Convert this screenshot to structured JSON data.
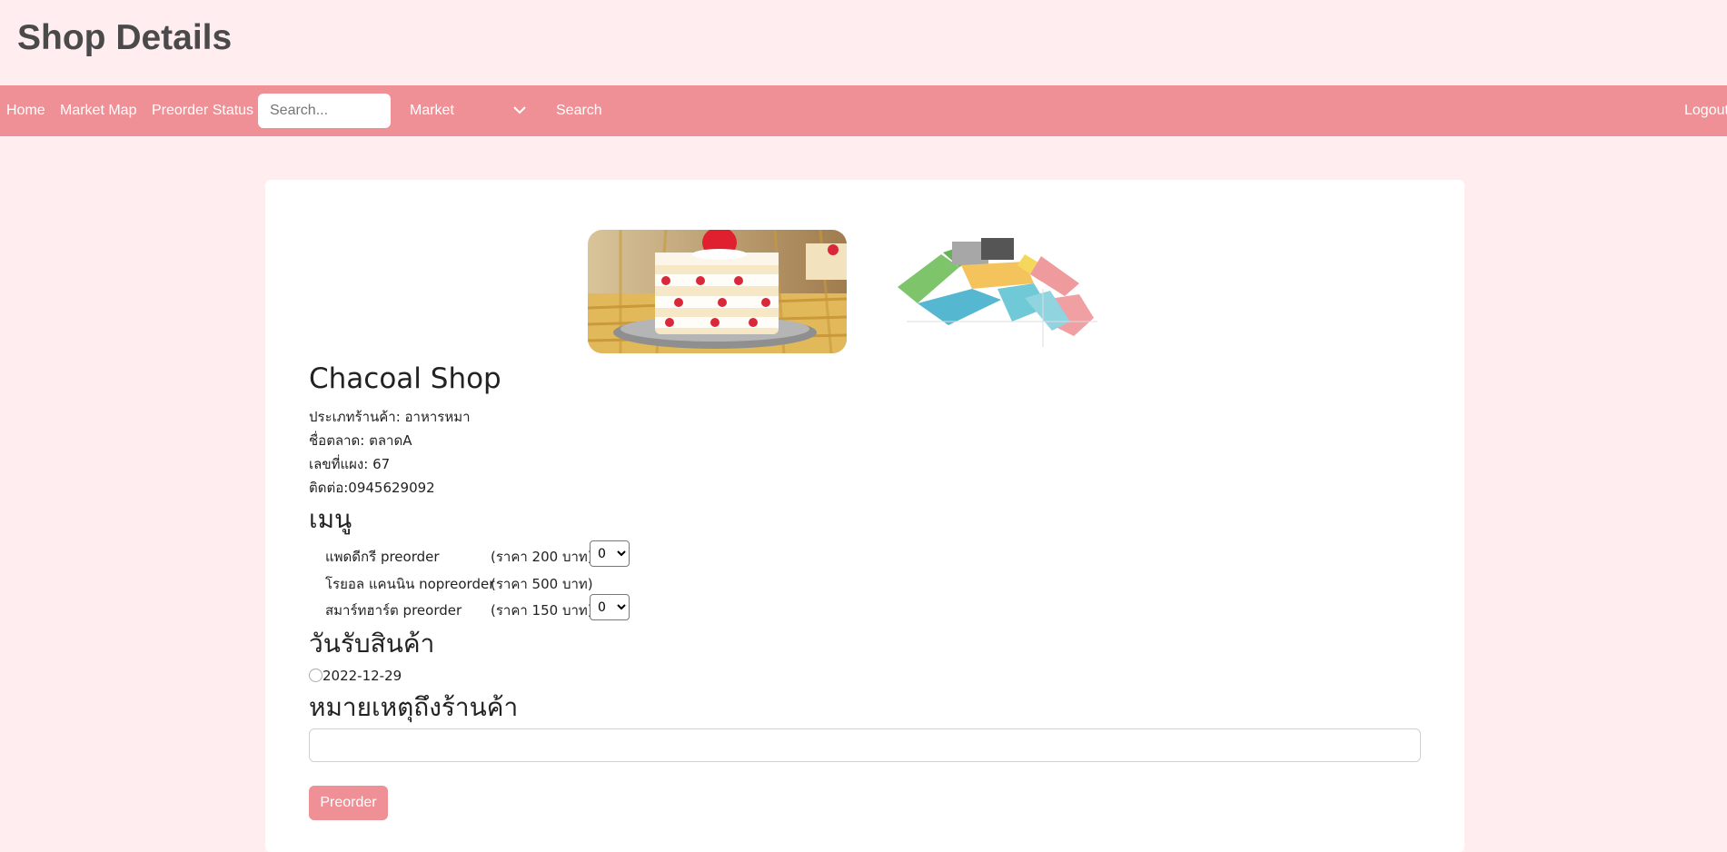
{
  "page": {
    "title": "Shop Details"
  },
  "nav": {
    "home": "Home",
    "market_map": "Market Map",
    "preorder_status": "Preorder Status",
    "search_placeholder": "Search...",
    "market_select": "Market",
    "search_button": "Search",
    "logout": "Logout"
  },
  "shop": {
    "name": "Chacoal Shop",
    "type": "ประเภทร้านค้า: อาหารหมา",
    "market": "ชื่อตลาด: ตลาดA",
    "stall": "เลขที่แผง: 67",
    "contact": "ติดต่อ:0945629092"
  },
  "menu": {
    "heading": "เมนู",
    "items": [
      {
        "name": "แพดดีกรี preorder",
        "price": "(ราคา 200 บาท)",
        "qty": "0"
      },
      {
        "name": "โรยอล แคนนิน nopreorder",
        "price": "(ราคา 500 บาท)"
      },
      {
        "name": "สมาร์ทฮาร์ต preorder",
        "price": "(ราคา 150 บาท)",
        "qty": "0"
      }
    ]
  },
  "pickup": {
    "heading": "วันรับสินค้า",
    "date": "2022-12-29"
  },
  "note": {
    "heading": "หมายเหตุถึงร้านค้า",
    "value": ""
  },
  "actions": {
    "preorder": "Preorder"
  },
  "colors": {
    "navbar": "#ee9095",
    "background": "#ffedf0",
    "button": "#ee9095"
  }
}
